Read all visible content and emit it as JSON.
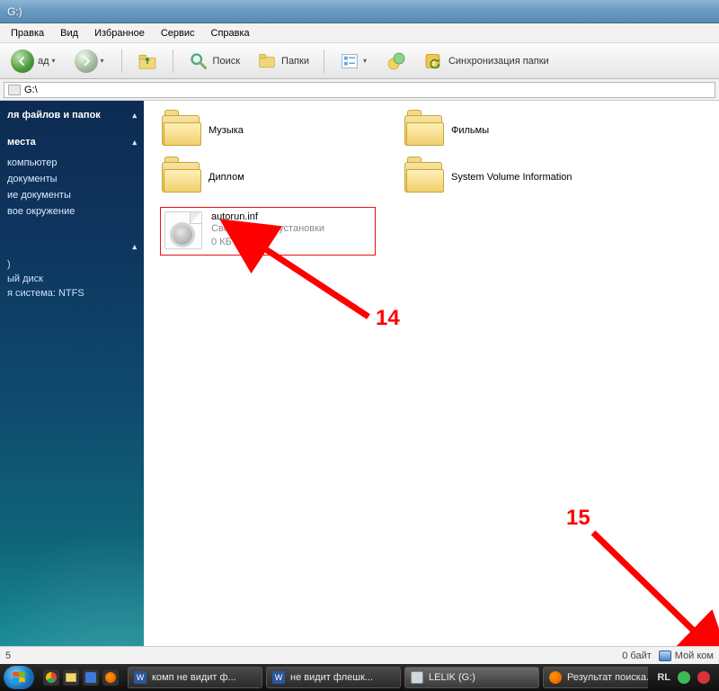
{
  "window": {
    "title": "G:)"
  },
  "menu": [
    "Правка",
    "Вид",
    "Избранное",
    "Сервис",
    "Справка"
  ],
  "toolbar": {
    "back_label": "ад",
    "search_label": "Поиск",
    "folders_label": "Папки",
    "sync_label": "Синхронизация папки"
  },
  "address": {
    "path": "G:\\"
  },
  "sidebar": {
    "tasks_header": "ля файлов и папок",
    "places_header": "места",
    "places": [
      "компьютер",
      "документы",
      "ие документы",
      "вое окружение"
    ],
    "details": {
      "drive_label": ")",
      "type": "ый диск",
      "fs": "я система: NTFS"
    }
  },
  "files": {
    "folders": [
      "Музыка",
      "Фильмы",
      "Диплом",
      "System Volume Information"
    ],
    "autorun": {
      "name": "autorun.inf",
      "desc": "Сведения для установки",
      "size": "0 КБ"
    }
  },
  "status": {
    "left": "5",
    "size": "0 байт",
    "location": "Мой ком"
  },
  "taskbar": {
    "items": [
      {
        "label": "комп не видит ф...",
        "app": "word"
      },
      {
        "label": "не видит флешк...",
        "app": "word"
      },
      {
        "label": "LELIK (G:)",
        "app": "explorer"
      },
      {
        "label": "Результат поиска...",
        "app": "firefox"
      }
    ],
    "lang": "RL"
  },
  "annotations": {
    "a14": "14",
    "a15": "15"
  }
}
